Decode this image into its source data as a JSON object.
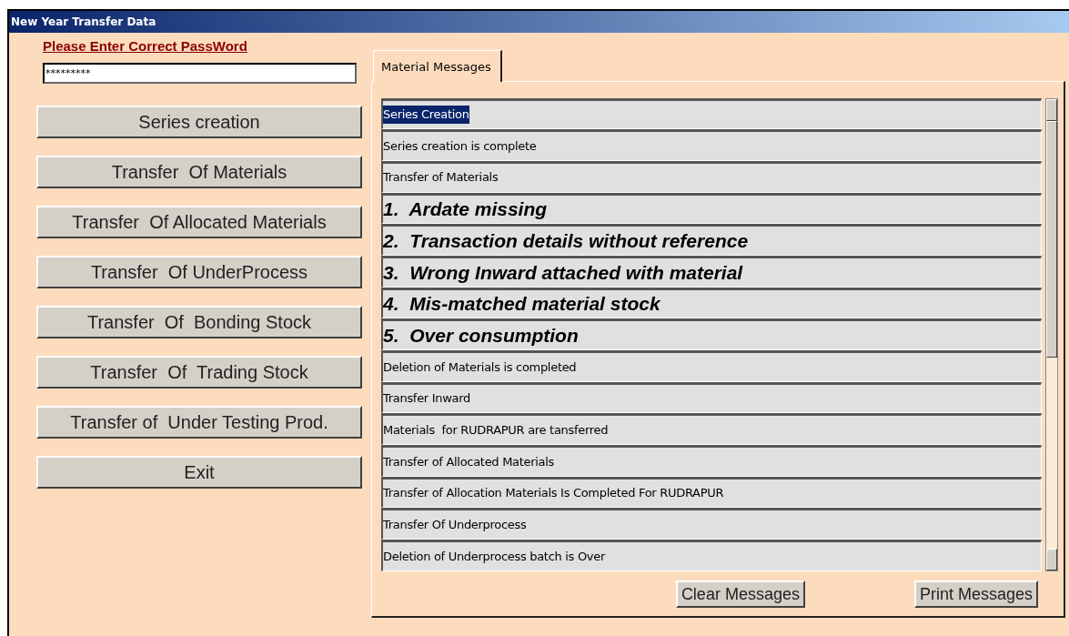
{
  "window": {
    "title": "New Year Transfer Data"
  },
  "password": {
    "label": "Please Enter Correct PassWord",
    "value": "*********"
  },
  "buttons": [
    "Series creation",
    "Transfer  Of Materials",
    "Transfer  Of Allocated Materials",
    "Transfer  Of UnderProcess",
    "Transfer  Of  Bonding Stock",
    "Transfer  Of  Trading Stock",
    "Transfer of  Under Testing Prod.",
    "Exit"
  ],
  "tabs": [
    {
      "label": "Material Messages",
      "selected": true
    }
  ],
  "messages": [
    {
      "text": "Series Creation",
      "kind": "plain",
      "selected": true
    },
    {
      "text": "Series creation is complete",
      "kind": "plain",
      "selected": false
    },
    {
      "text": "Transfer of Materials",
      "kind": "plain",
      "selected": false
    },
    {
      "text": "1.  Ardate missing",
      "kind": "bold",
      "selected": false
    },
    {
      "text": "2.  Transaction details without reference",
      "kind": "bold",
      "selected": false
    },
    {
      "text": "3.  Wrong Inward attached with material",
      "kind": "bold",
      "selected": false
    },
    {
      "text": "4.  Mis-matched material stock",
      "kind": "bold",
      "selected": false
    },
    {
      "text": "5.  Over consumption",
      "kind": "bold",
      "selected": false
    },
    {
      "text": "Deletion of Materials is completed",
      "kind": "plain",
      "selected": false
    },
    {
      "text": "Transfer Inward",
      "kind": "plain",
      "selected": false
    },
    {
      "text": "Materials  for RUDRAPUR are tansferred",
      "kind": "plain",
      "selected": false
    },
    {
      "text": "Transfer of Allocated Materials",
      "kind": "plain",
      "selected": false
    },
    {
      "text": "Transfer of Allocation Materials Is Completed For RUDRAPUR",
      "kind": "plain",
      "selected": false
    },
    {
      "text": "Transfer Of Underprocess",
      "kind": "plain",
      "selected": false
    },
    {
      "text": "Deletion of Underprocess batch is Over",
      "kind": "plain",
      "selected": false
    }
  ],
  "actions": [
    "Clear Messages",
    "Print Messages"
  ]
}
